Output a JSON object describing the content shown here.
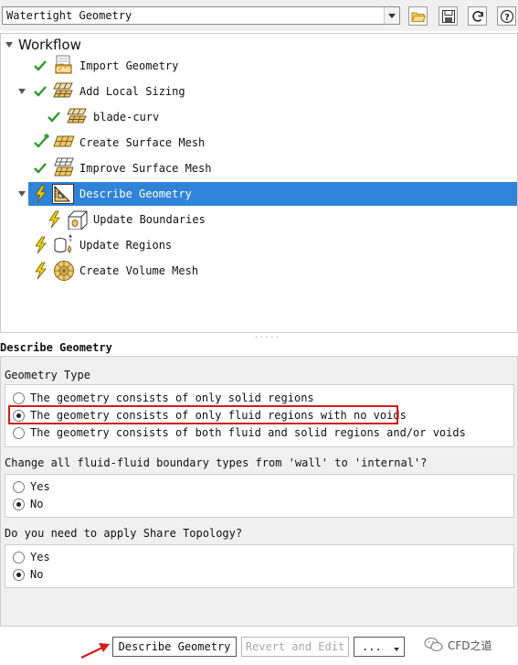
{
  "toolbar": {
    "workflow_select_value": "Watertight Geometry",
    "icons": [
      "folder-open-icon",
      "save-icon",
      "refresh-icon",
      "help-icon"
    ],
    "help_glyph": "?"
  },
  "tree": {
    "title": "Workflow",
    "items": [
      {
        "label": "Import Geometry",
        "status": "done",
        "icon": "cad-import-icon"
      },
      {
        "label": "Add Local Sizing",
        "status": "done",
        "icon": "mesh-sizing-icon",
        "expanded": true
      },
      {
        "label": "blade-curv",
        "status": "done",
        "icon": "mesh-sizing-icon"
      },
      {
        "label": "Create Surface Mesh",
        "status": "done-modified",
        "icon": "surface-mesh-icon"
      },
      {
        "label": "Improve Surface Mesh",
        "status": "done",
        "icon": "improve-mesh-icon"
      },
      {
        "label": "Describe Geometry",
        "status": "pending",
        "icon": "describe-geometry-icon",
        "expanded": true,
        "selected": true
      },
      {
        "label": "Update Boundaries",
        "status": "pending",
        "icon": "boundaries-icon"
      },
      {
        "label": "Update Regions",
        "status": "pending",
        "icon": "regions-icon"
      },
      {
        "label": "Create Volume Mesh",
        "status": "pending",
        "icon": "volume-mesh-icon"
      }
    ]
  },
  "panel": {
    "title": "Describe Geometry",
    "geometry_type": {
      "label": "Geometry Type",
      "options": [
        "The geometry consists of only solid regions",
        "The geometry consists of only fluid regions with no voids",
        "The geometry consists of both fluid and solid regions and/or voids"
      ],
      "selected_index": 1
    },
    "fluid_fluid": {
      "label": "Change all fluid-fluid boundary types from 'wall' to 'internal'?",
      "options": [
        "Yes",
        "No"
      ],
      "selected_index": 1
    },
    "share_topology": {
      "label": "Do you need to apply Share Topology?",
      "options": [
        "Yes",
        "No"
      ],
      "selected_index": 1
    }
  },
  "buttons": {
    "describe": "Describe Geometry",
    "revert": "Revert and Edit",
    "more": "..."
  },
  "watermark": "CFD之道",
  "colors": {
    "selection": "#2f83d8",
    "check": "#2e9a2e",
    "pending_bolt": "#f2d10d",
    "highlight_box": "#d01c1c"
  }
}
